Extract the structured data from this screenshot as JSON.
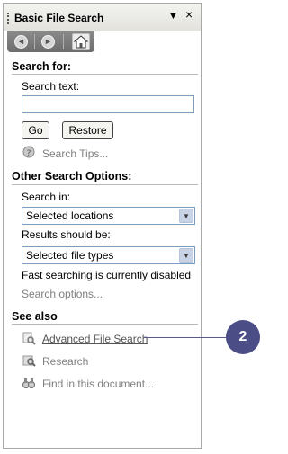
{
  "titlebar": {
    "title": "Basic File Search",
    "menu_glyph": "▼",
    "close_glyph": "×"
  },
  "navbar": {
    "back_glyph": "◄",
    "forward_glyph": "►",
    "home_icon": "home-icon"
  },
  "search_for": {
    "heading": "Search for:",
    "search_text_label": "Search text:",
    "search_text_value": "",
    "go_label": "Go",
    "restore_label": "Restore",
    "tips_icon": "help-icon",
    "tips_label": "Search Tips..."
  },
  "other_options": {
    "heading": "Other Search Options:",
    "search_in_label": "Search in:",
    "search_in_value": "Selected locations",
    "results_label": "Results should be:",
    "results_value": "Selected file types",
    "status_text": "Fast searching is currently disabled",
    "search_options_label": "Search options..."
  },
  "see_also": {
    "heading": "See also",
    "items": [
      {
        "label": "Advanced File Search",
        "icon": "advanced-search-icon"
      },
      {
        "label": "Research",
        "icon": "research-icon"
      },
      {
        "label": "Find in this document...",
        "icon": "binoculars-icon"
      }
    ]
  },
  "callout": {
    "number": "2",
    "color": "#4b4d86"
  }
}
